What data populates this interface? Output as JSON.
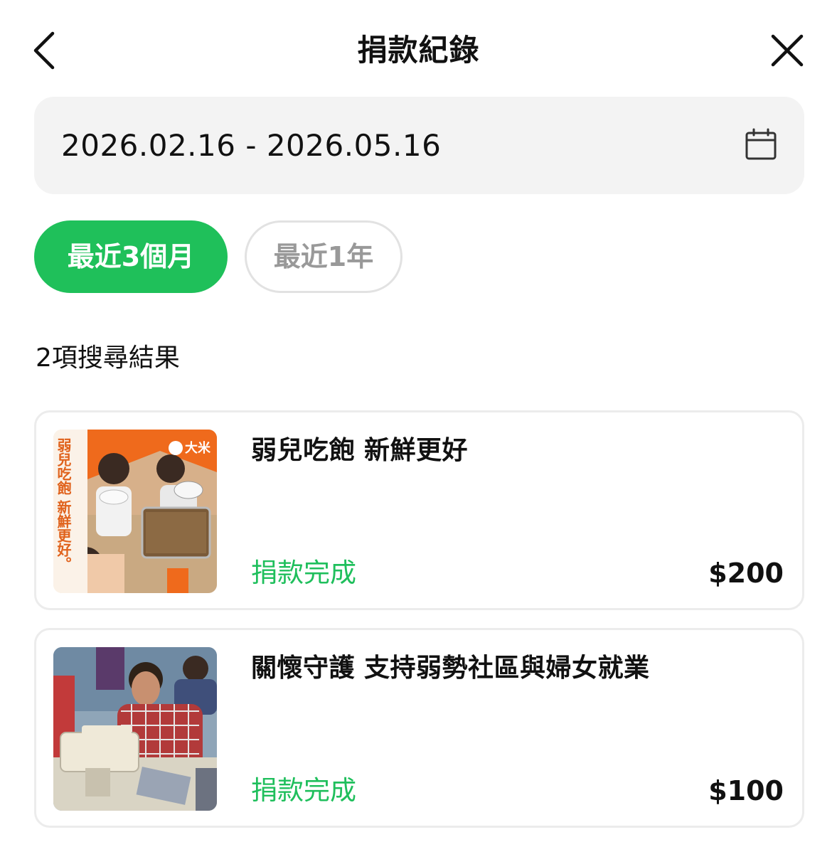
{
  "header": {
    "title": "捐款紀錄"
  },
  "date_range": {
    "value": "2026.02.16 - 2026.05.16"
  },
  "filters": [
    {
      "label": "最近3個月",
      "selected": true
    },
    {
      "label": "最近1年",
      "selected": false
    }
  ],
  "results": {
    "count_text": "2項搜尋結果"
  },
  "donations": [
    {
      "title": "弱兒吃飽 新鮮更好",
      "status": "捐款完成",
      "amount": "$200",
      "thumbnail_text": "弱兒吃飽 新鮮更好。",
      "thumbnail_logo": "大米"
    },
    {
      "title": "關懷守護 支持弱勢社區與婦女就業",
      "status": "捐款完成",
      "amount": "$100"
    }
  ],
  "colors": {
    "accent_green": "#1fc05a",
    "status_green": "#1fbf5c",
    "field_bg": "#f3f3f3",
    "chip_border": "#e2e2e2",
    "thumb_orange": "#ef6a1c"
  }
}
